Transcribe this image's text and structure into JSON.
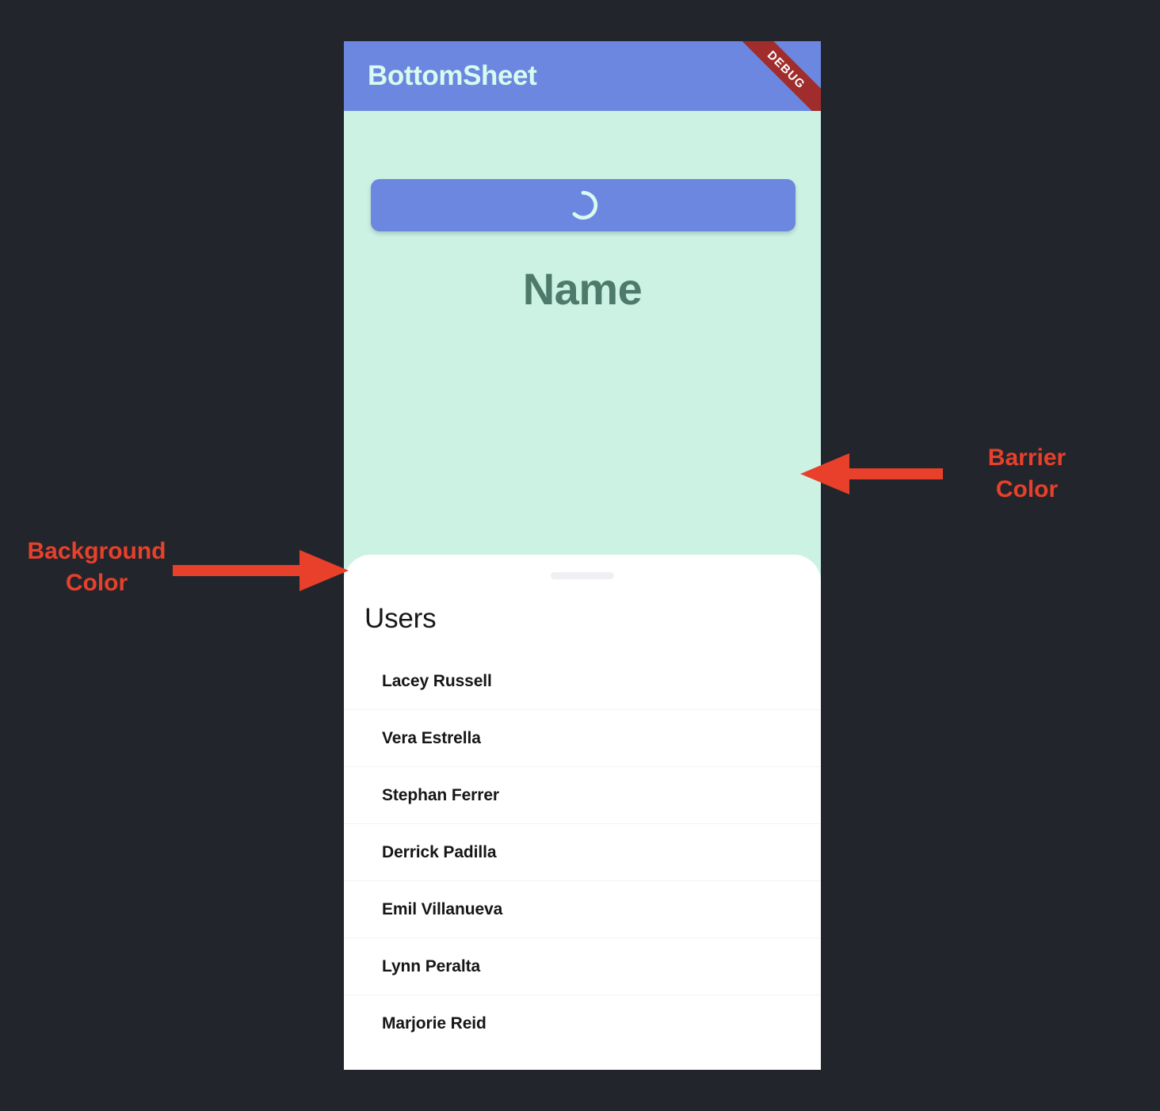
{
  "app": {
    "title": "BottomSheet",
    "debug_banner": "DEBUG"
  },
  "body": {
    "load_button": {
      "icon": "circular-progress-spinner-icon",
      "label": ""
    },
    "name_heading": "Name"
  },
  "bottom_sheet": {
    "handle": "drag-handle",
    "title": "Users",
    "users": [
      {
        "name": "Lacey Russell"
      },
      {
        "name": "Vera Estrella"
      },
      {
        "name": "Stephan Ferrer"
      },
      {
        "name": "Derrick Padilla"
      },
      {
        "name": "Emil Villanueva"
      },
      {
        "name": "Lynn Peralta"
      },
      {
        "name": "Marjorie Reid"
      }
    ]
  },
  "annotations": [
    {
      "text": "Barrier\nColor",
      "arrow": "left"
    },
    {
      "text": "Background\nColor",
      "arrow": "right"
    }
  ],
  "colors": {
    "page_background": "#22262c",
    "app_bar": "#6c87df",
    "app_bar_title": "#d9fbef",
    "debug_ribbon": "#a02c2c",
    "barrier_color": "#ccf2e4",
    "background_color": "#3a28d8",
    "sheet_surface": "#ffffff",
    "name_heading": "#4e7a6c",
    "annotation_accent": "#e8402a",
    "drag_handle": "#eff0f4",
    "divider": "#f3f3f5"
  }
}
